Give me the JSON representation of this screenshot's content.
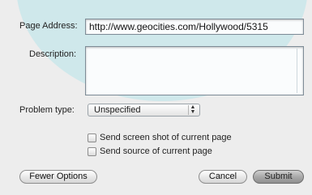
{
  "form": {
    "page_address_label": "Page Address:",
    "page_address_value": "http://www.geocities.com/Hollywood/5315",
    "description_label": "Description:",
    "description_value": "",
    "problem_type_label": "Problem type:",
    "problem_type_selected": "Unspecified",
    "checkbox_screenshot_label": "Send screen shot of current page",
    "checkbox_screenshot_checked": false,
    "checkbox_source_label": "Send source of current page",
    "checkbox_source_checked": false
  },
  "buttons": {
    "fewer_options": "Fewer Options",
    "cancel": "Cancel",
    "submit": "Submit"
  },
  "icons": {
    "select_arrows": "up-down-arrows-icon"
  }
}
